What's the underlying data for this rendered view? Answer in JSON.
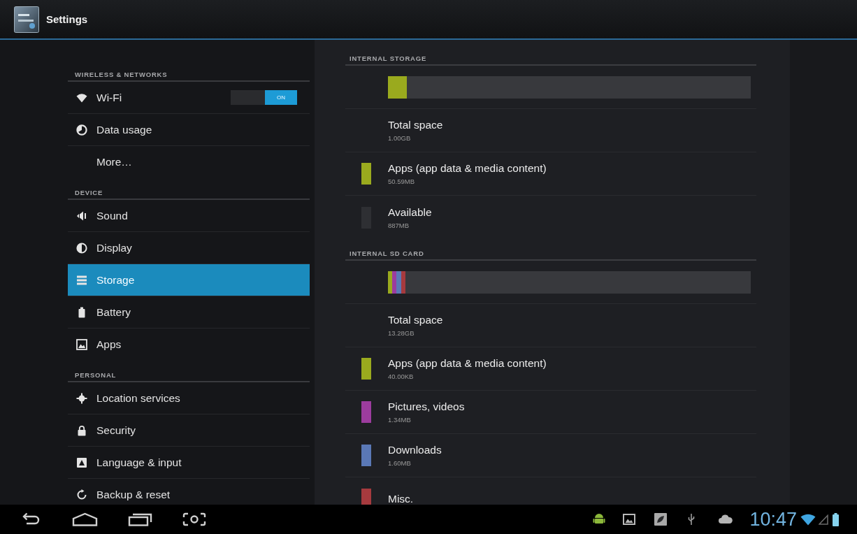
{
  "action_bar": {
    "title": "Settings"
  },
  "sidebar": {
    "groups": [
      {
        "header": "WIRELESS & NETWORKS",
        "items": [
          {
            "label": "Wi-Fi",
            "selected": false,
            "switch": {
              "label": "ON",
              "on": true
            }
          },
          {
            "label": "Data usage",
            "selected": false
          },
          {
            "label": "More…",
            "selected": false
          }
        ]
      },
      {
        "header": "DEVICE",
        "items": [
          {
            "label": "Sound",
            "selected": false
          },
          {
            "label": "Display",
            "selected": false
          },
          {
            "label": "Storage",
            "selected": true
          },
          {
            "label": "Battery",
            "selected": false
          },
          {
            "label": "Apps",
            "selected": false
          }
        ]
      },
      {
        "header": "PERSONAL",
        "items": [
          {
            "label": "Location services",
            "selected": false
          },
          {
            "label": "Security",
            "selected": false
          },
          {
            "label": "Language & input",
            "selected": false
          },
          {
            "label": "Backup & reset",
            "selected": false
          }
        ]
      }
    ]
  },
  "storage": {
    "sections": [
      {
        "header": "INTERNAL STORAGE",
        "items": [
          {
            "kind": "total",
            "title": "Total space",
            "value": "1.00GB"
          },
          {
            "kind": "category",
            "title": "Apps (app data & media content)",
            "value": "50.59MB",
            "color": "#9aaa1e",
            "level": 0.052
          },
          {
            "kind": "category",
            "title": "Available",
            "value": "887MB",
            "color": "#2e2f33"
          }
        ]
      },
      {
        "header": "INTERNAL SD CARD",
        "items": [
          {
            "kind": "total",
            "title": "Total space",
            "value": "13.28GB"
          },
          {
            "kind": "category",
            "title": "Apps (app data & media content)",
            "value": "40.00KB",
            "color": "#9aaa1e",
            "level": 0.012
          },
          {
            "kind": "category",
            "title": "Pictures, videos",
            "value": "1.34MB",
            "color": "#9c3c9e",
            "level": 0.012
          },
          {
            "kind": "category",
            "title": "Downloads",
            "value": "1.60MB",
            "color": "#5a78b6",
            "level": 0.012
          },
          {
            "kind": "category",
            "title": "Misc.",
            "color": "#a63a3e",
            "level": 0.012
          }
        ]
      }
    ]
  },
  "navigation_bar": {
    "time": "10:47"
  }
}
